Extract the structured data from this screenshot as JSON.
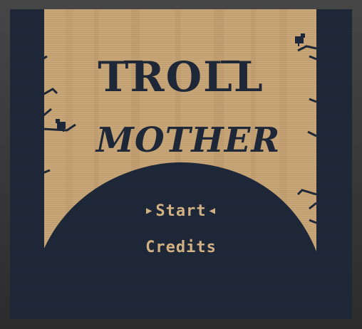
{
  "game": {
    "title_line1": "TROLL",
    "title_line2": "MOTHER"
  },
  "menu": {
    "start_label": "Start",
    "credits_label": "Credits",
    "selected": "Start",
    "cursor_left": "▶",
    "cursor_right": "◀"
  },
  "colors": {
    "background_dark": "#1e2838",
    "forest_tan": "#c9a677",
    "menu_text": "#d6b486"
  },
  "icons": [
    "bird-icon",
    "bird-icon",
    "tree-branch-icon"
  ]
}
